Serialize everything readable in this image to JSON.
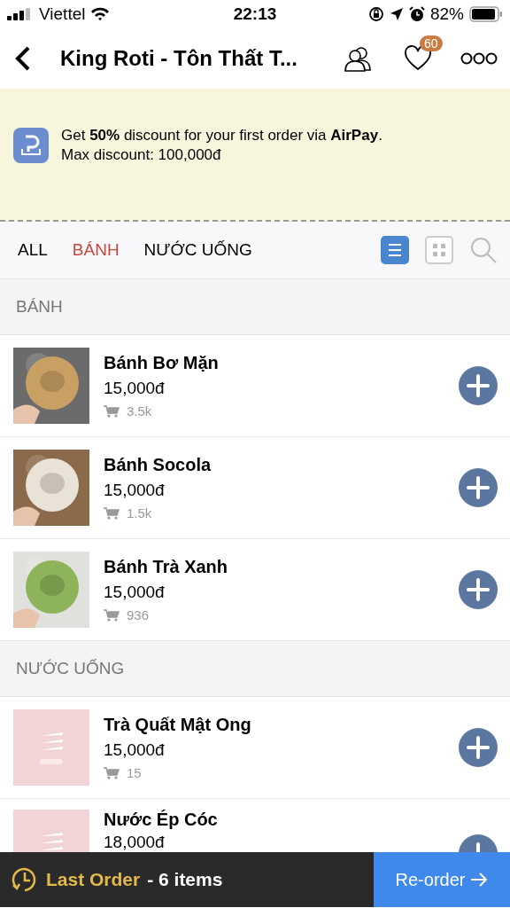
{
  "status_bar": {
    "carrier": "Viettel",
    "time": "22:13",
    "battery": "82%"
  },
  "header": {
    "title": "King Roti - Tôn Thất T...",
    "favorites_badge": "60"
  },
  "promo": {
    "text": "Get **50%** discount for your first order via **AirPay**.",
    "subtext": "Max discount: 100,000đ"
  },
  "tabs": [
    {
      "label": "ALL",
      "selected": false
    },
    {
      "label": "BÁNH",
      "selected": true
    },
    {
      "label": "NƯỚC UỐNG",
      "selected": false
    }
  ],
  "view_modes": [
    {
      "kind": "list",
      "selected": true
    },
    {
      "kind": "grid",
      "selected": false
    }
  ],
  "sections": [
    {
      "title": "BÁNH",
      "items": [
        {
          "name": "Bánh Bơ Mặn",
          "price": "15,000đ",
          "sold": "3.5k",
          "kind": "bun"
        },
        {
          "name": "Bánh Socola",
          "price": "15,000đ",
          "sold": "1.5k",
          "kind": "choco"
        },
        {
          "name": "Bánh Trà Xanh",
          "price": "15,000đ",
          "sold": "936",
          "kind": "matcha"
        }
      ]
    },
    {
      "title": "NƯỚC UỐNG",
      "items": [
        {
          "name": "Trà Quất Mật Ong",
          "price": "15,000đ",
          "sold": "15",
          "kind": "placeholder"
        },
        {
          "name": "Nước Ép Cóc",
          "price": "18,000đ",
          "kind": "placeholder"
        }
      ]
    }
  ],
  "last_order": {
    "label": "Last Order",
    "summary": "- 6 items",
    "button": "Re-order"
  }
}
